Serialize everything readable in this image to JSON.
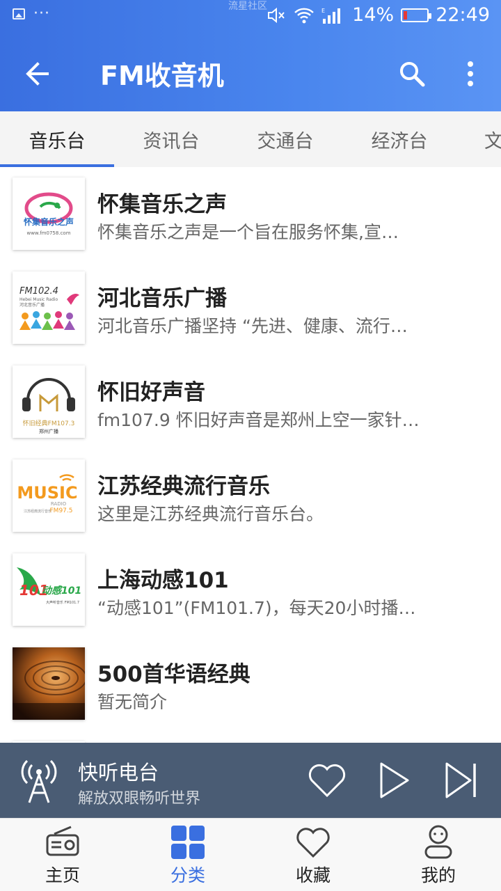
{
  "status_bar": {
    "watermark": "流星社区",
    "battery": "14%",
    "time": "22:49",
    "battery_level": 0.14
  },
  "app_bar": {
    "title": "FM收音机"
  },
  "tabs": [
    {
      "label": "音乐台",
      "active": true
    },
    {
      "label": "资讯台",
      "active": false
    },
    {
      "label": "交通台",
      "active": false
    },
    {
      "label": "经济台",
      "active": false
    },
    {
      "label": "文",
      "active": false
    }
  ],
  "stations": [
    {
      "title": "怀集音乐之声",
      "desc": "怀集音乐之声是一个旨在服务怀集,宣…",
      "logo": {
        "line1": "怀集音乐之声",
        "line2": "www.fm0758.com"
      }
    },
    {
      "title": "河北音乐广播",
      "desc": "河北音乐广播坚持 “先进、健康、流行…",
      "logo": {
        "line1": "FM102.4",
        "line2": "Hebei Music Radio",
        "line3": "河北音乐广播"
      }
    },
    {
      "title": "怀旧好声音",
      "desc": "fm107.9 怀旧好声音是郑州上空一家针…",
      "logo": {
        "line1": "怀旧经典FM107.3",
        "line2": "郑州广播"
      }
    },
    {
      "title": "江苏经典流行音乐",
      "desc": "这里是江苏经典流行音乐台。",
      "logo": {
        "line1": "MUSIC",
        "line2": "RADIO",
        "line3": "FM97.5",
        "line4": "江苏经典流行音乐"
      }
    },
    {
      "title": "上海动感101",
      "desc": "“动感101”(FM101.7)，每天20小时播…",
      "logo": {
        "line1": "101",
        "line2": "动感101",
        "line3": "大声听音乐 FM101.7"
      }
    },
    {
      "title": "500首华语经典",
      "desc": "暂无简介",
      "logo": {}
    }
  ],
  "player": {
    "title": "快听电台",
    "subtitle": "解放双眼畅听世界"
  },
  "bottom_nav": [
    {
      "label": "主页",
      "icon": "radio-icon",
      "active": false
    },
    {
      "label": "分类",
      "icon": "category-grid-icon",
      "active": true
    },
    {
      "label": "收藏",
      "icon": "heart-icon",
      "active": false
    },
    {
      "label": "我的",
      "icon": "user-icon",
      "active": false
    }
  ],
  "colors": {
    "primary": "#3a6fe0",
    "player_bg": "#4a5c74",
    "tabs_bg": "#f4f4f4"
  }
}
